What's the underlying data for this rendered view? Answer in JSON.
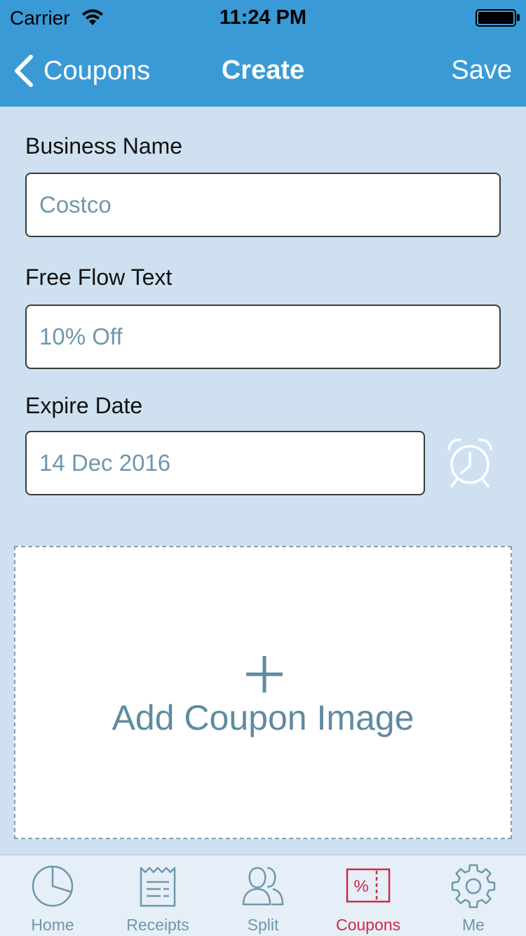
{
  "status_bar": {
    "carrier": "Carrier",
    "time": "11:24 PM"
  },
  "nav": {
    "back_label": "Coupons",
    "title": "Create",
    "save_label": "Save"
  },
  "form": {
    "business_name": {
      "label": "Business Name",
      "value": "Costco"
    },
    "free_flow_text": {
      "label": "Free Flow Text",
      "value": "10% Off"
    },
    "expire_date": {
      "label": "Expire Date",
      "value": "14 Dec 2016"
    }
  },
  "add_image": {
    "label": "Add Coupon Image"
  },
  "tabs": [
    {
      "label": "Home",
      "icon": "pie-chart-icon",
      "active": false
    },
    {
      "label": "Receipts",
      "icon": "receipt-icon",
      "active": false
    },
    {
      "label": "Split",
      "icon": "users-icon",
      "active": false
    },
    {
      "label": "Coupons",
      "icon": "coupon-icon",
      "active": true
    },
    {
      "label": "Me",
      "icon": "gear-icon",
      "active": false
    }
  ],
  "colors": {
    "header": "#3a9ad6",
    "background": "#cfe1f0",
    "accent_inactive": "#6f97ad",
    "accent_active": "#cc2b45"
  }
}
